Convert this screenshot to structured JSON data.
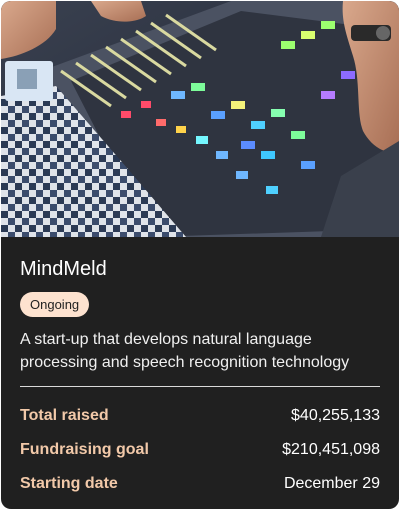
{
  "card": {
    "title": "MindMeld",
    "status": "Ongoing",
    "description": "A start-up that develops natural language processing and speech recognition technology",
    "stats": [
      {
        "label": "Total raised",
        "value": "$40,255,133"
      },
      {
        "label": "Fundraising goal",
        "value": "$210,451,098"
      },
      {
        "label": "Starting date",
        "value": "December 29"
      }
    ]
  },
  "colors": {
    "card_background": "#202020",
    "badge_background": "#fde2cf",
    "label_accent": "#f2c9a9"
  },
  "image": {
    "subject": "hands operating an audio mixing console"
  }
}
